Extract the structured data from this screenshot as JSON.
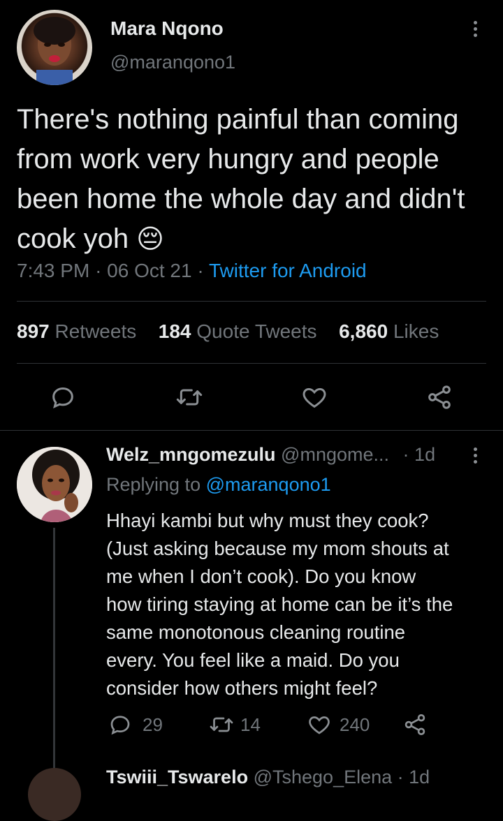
{
  "tweet": {
    "author_name": "Mara Nqono",
    "author_handle": "@maranqono1",
    "text": "There's nothing painful than coming from work very hungry and people been home the whole day and didn't cook yoh",
    "emoji": "😔",
    "time": "7:43 PM",
    "date": "06 Oct 21",
    "client": "Twitter for Android",
    "stats": {
      "retweets_count": "897",
      "retweets_label": "Retweets",
      "quotes_count": "184",
      "quotes_label": "Quote Tweets",
      "likes_count": "6,860",
      "likes_label": "Likes"
    },
    "icons": [
      "reply-icon",
      "retweet-icon",
      "like-icon",
      "share-icon"
    ]
  },
  "reply": {
    "author_name": "Welz_mngomezulu",
    "author_handle": "@mngome...",
    "age": "1d",
    "replying_prefix": "Replying to",
    "replying_to": "@maranqono1",
    "text_lines": [
      "Hhayi kambi but why must they cook?",
      "(Just asking because my mom shouts at",
      "me when I don’t cook). Do you know",
      "how tiring staying at home can be it’s the",
      "same monotonous cleaning routine",
      "every. You feel like a maid. Do you",
      "consider how others might feel?"
    ],
    "reply_count": "29",
    "retweet_count": "14",
    "like_count": "240"
  },
  "next_reply": {
    "author_name": "Tswiii_Tswarelo",
    "author_handle": "@Tshego_Elena",
    "age": "1d"
  },
  "colors": {
    "background": "#000000",
    "text": "#e7e9ea",
    "muted": "#71767b",
    "link": "#1d9bf0",
    "divider": "#2f3336"
  }
}
